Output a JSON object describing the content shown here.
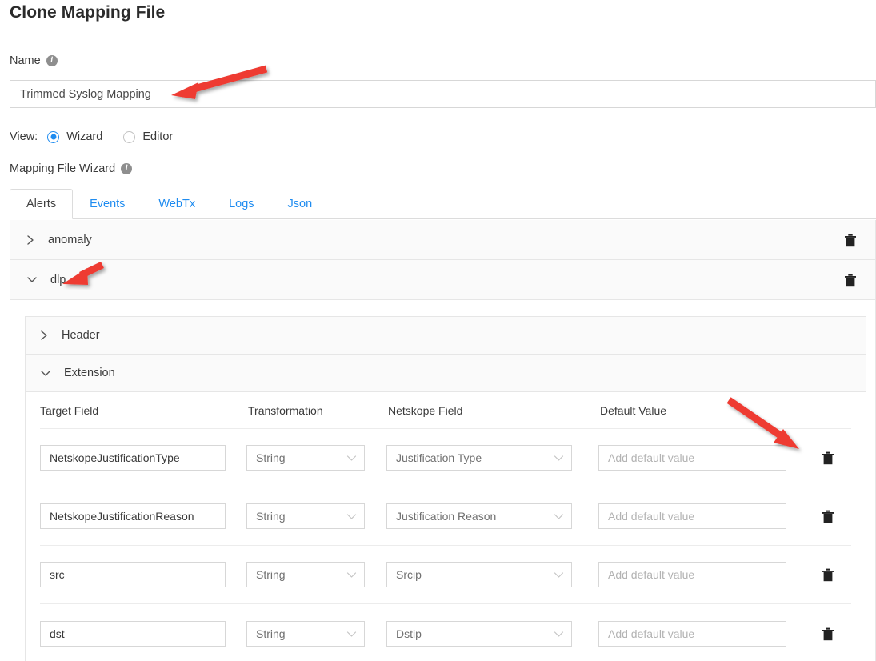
{
  "dialog": {
    "title": "Clone Mapping File"
  },
  "name_field": {
    "label": "Name",
    "info_icon": "info-icon",
    "value": "Trimmed Syslog Mapping",
    "placeholder": ""
  },
  "view": {
    "label": "View:",
    "selected": "Wizard",
    "options": [
      {
        "label": "Wizard",
        "selected": true
      },
      {
        "label": "Editor",
        "selected": false
      }
    ]
  },
  "wizard": {
    "label": "Mapping File Wizard",
    "info_icon": "info-icon"
  },
  "tabs": [
    {
      "label": "Alerts",
      "active": true
    },
    {
      "label": "Events",
      "active": false
    },
    {
      "label": "WebTx",
      "active": false
    },
    {
      "label": "Logs",
      "active": false
    },
    {
      "label": "Json",
      "active": false
    }
  ],
  "groups": [
    {
      "label": "anomaly",
      "expanded": false,
      "chevron": "chevron-right-icon",
      "delete_icon": "trash-icon"
    },
    {
      "label": "dlp",
      "expanded": true,
      "chevron": "chevron-down-icon",
      "delete_icon": "trash-icon"
    }
  ],
  "subsections": [
    {
      "label": "Header",
      "expanded": false,
      "chevron": "chevron-right-icon"
    },
    {
      "label": "Extension",
      "expanded": true,
      "chevron": "chevron-down-icon"
    }
  ],
  "table": {
    "columns": [
      "Target Field",
      "Transformation",
      "Netskope Field",
      "Default Value"
    ],
    "default_value_placeholder": "Add default value",
    "rows": [
      {
        "target_field": "NetskopeJustificationType",
        "transformation": "String",
        "netskope_field": "Justification Type",
        "default_value": "",
        "delete_icon": "trash-icon"
      },
      {
        "target_field": "NetskopeJustificationReason",
        "transformation": "String",
        "netskope_field": "Justification Reason",
        "default_value": "",
        "delete_icon": "trash-icon"
      },
      {
        "target_field": "src",
        "transformation": "String",
        "netskope_field": "Srcip",
        "default_value": "",
        "delete_icon": "trash-icon"
      },
      {
        "target_field": "dst",
        "transformation": "String",
        "netskope_field": "Dstip",
        "default_value": "",
        "delete_icon": "trash-icon"
      }
    ]
  },
  "colors": {
    "accent_blue": "#1f8cf0",
    "annotation_red": "#ee3b33",
    "row_background": "#fafafa",
    "border": "#e6e6e6"
  },
  "annotations": [
    {
      "name": "arrow-to-name-input",
      "color": "#ee3b33"
    },
    {
      "name": "arrow-to-dlp-group",
      "color": "#ee3b33"
    },
    {
      "name": "arrow-to-row-delete",
      "color": "#ee3b33"
    }
  ]
}
